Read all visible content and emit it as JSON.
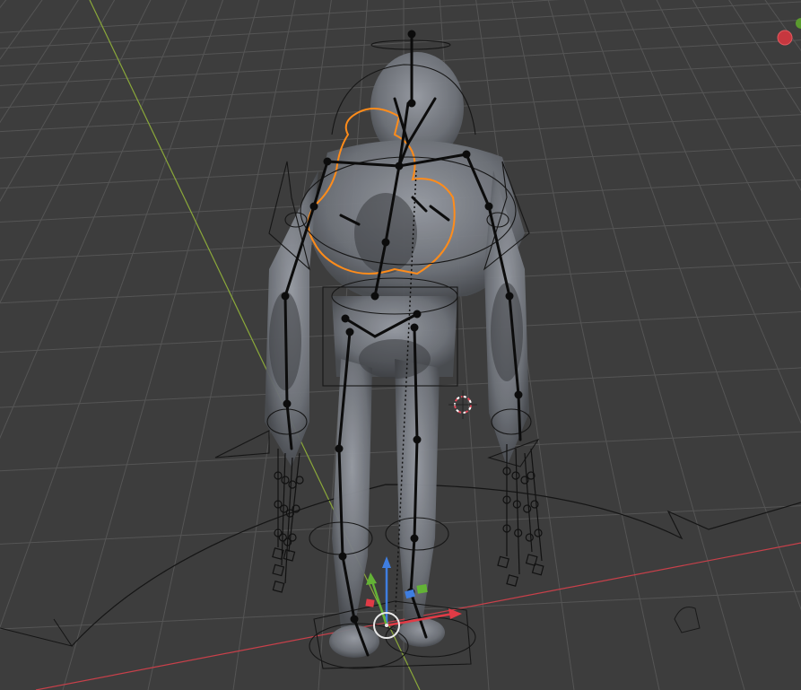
{
  "viewport": {
    "view": "3D Viewport",
    "colors": {
      "background": "#3d3d3d",
      "grid": "#555555",
      "axis_x": "#c8404a",
      "axis_y": "#8aa83a",
      "selection": "#ff8c1a",
      "armature": "#101010",
      "mesh": "#8a8e96",
      "gizmo_x": "#e03b46",
      "gizmo_y": "#63b336",
      "gizmo_z": "#3f7ee0"
    }
  },
  "scene": {
    "object": "character-rig",
    "mode": "pose",
    "transform_gizmo": "move",
    "icons": [
      "3d-cursor-icon",
      "transform-gizmo-icon",
      "navigation-gizmo-icon"
    ]
  }
}
